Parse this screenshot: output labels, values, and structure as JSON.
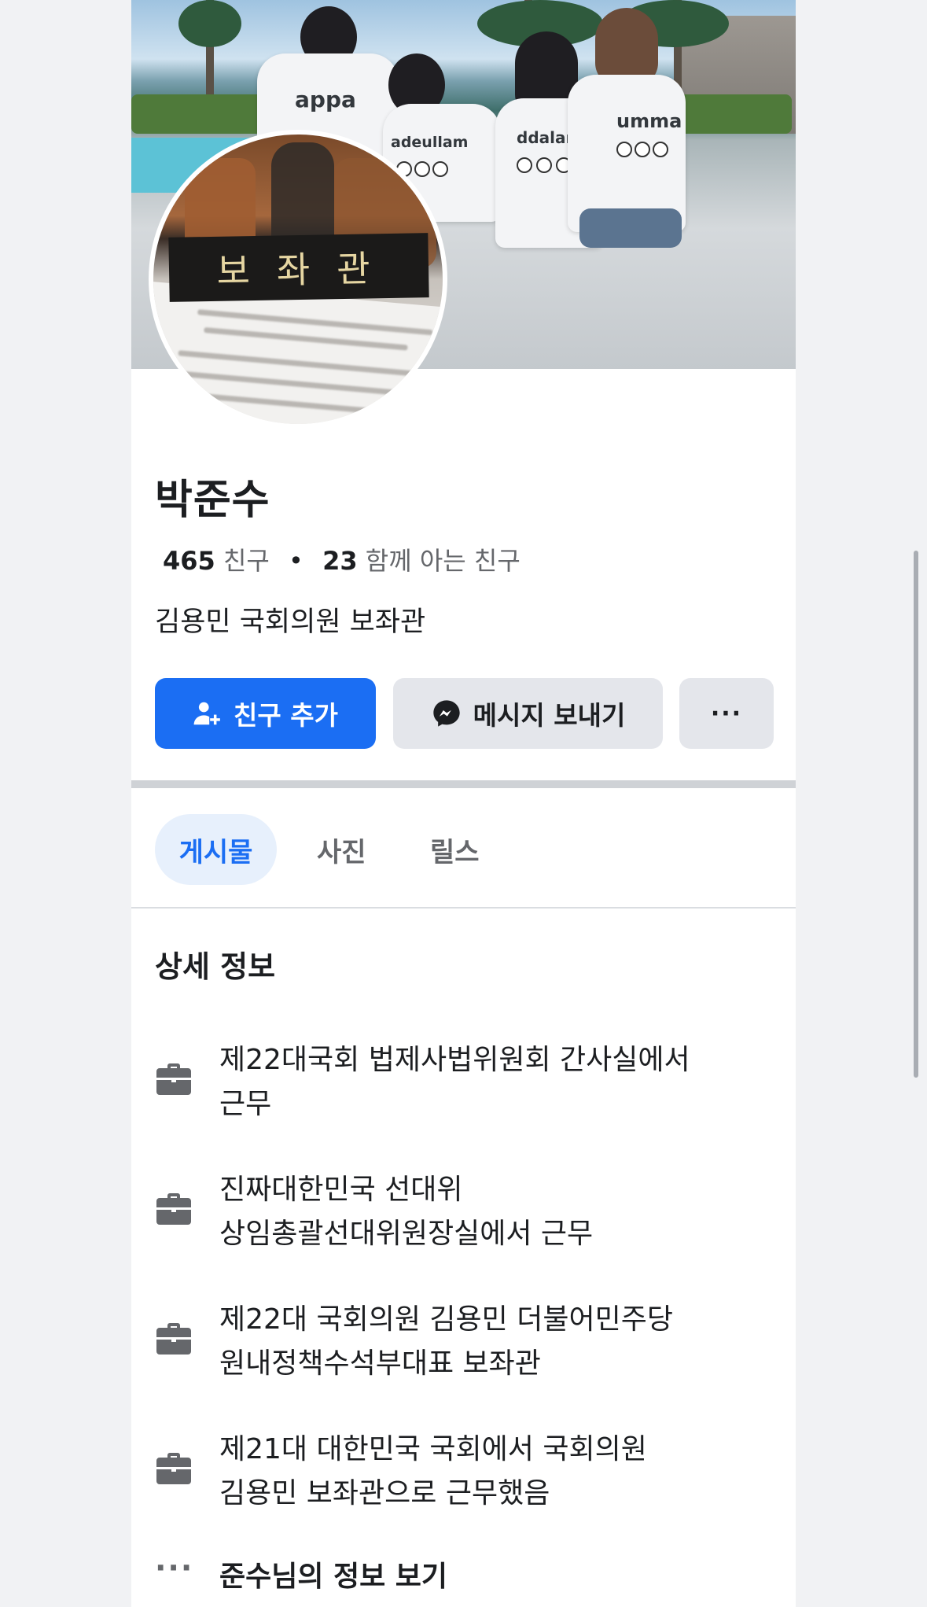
{
  "profile": {
    "name": "박준수",
    "friends_count": "465",
    "friends_label": "친구",
    "mutual_count": "23",
    "mutual_label": "함께 아는 친구",
    "bio": "김용민 국회의원 보좌관",
    "avatar_plate_text": "보좌관"
  },
  "cover": {
    "shirt_labels": [
      "appa",
      "adeullam",
      "ddalam",
      "umma"
    ]
  },
  "actions": {
    "add_friend": "친구 추가",
    "message": "메시지 보내기",
    "more": "···"
  },
  "tabs": [
    {
      "label": "게시물",
      "active": true
    },
    {
      "label": "사진",
      "active": false
    },
    {
      "label": "릴스",
      "active": false
    }
  ],
  "details": {
    "title": "상세 정보",
    "items": [
      {
        "icon": "briefcase-icon",
        "lines": [
          "제22대국회 법제사법위원회 간사실에서",
          "근무"
        ]
      },
      {
        "icon": "briefcase-icon",
        "lines": [
          "진짜대한민국 선대위",
          "상임총괄선대위원장실에서 근무"
        ]
      },
      {
        "icon": "briefcase-icon",
        "lines": [
          "제22대 국회의원 김용민 더불어민주당",
          "원내정책수석부대표 보좌관"
        ]
      },
      {
        "icon": "briefcase-icon",
        "lines": [
          "제21대 대한민국 국회에서 국회의원",
          "김용민 보좌관으로 근무했음"
        ]
      }
    ],
    "more_info": "준수님의 정보 보기",
    "more_icon": "···"
  },
  "colors": {
    "primary": "#1b6ef3",
    "button_gray": "#e4e6eb",
    "text": "#1c1e21",
    "secondary_text": "#65676b",
    "active_tab_bg": "#e7f0fc"
  }
}
